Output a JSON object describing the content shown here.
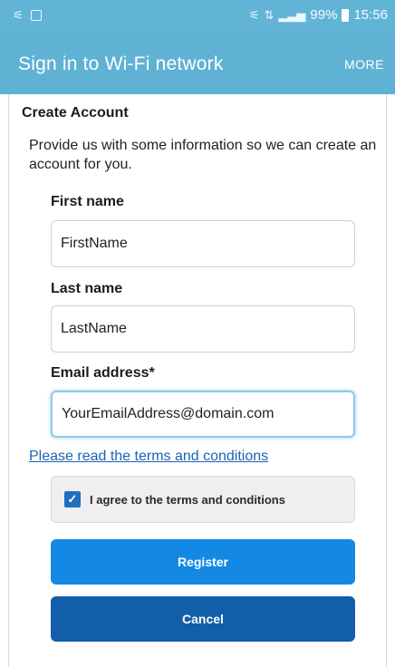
{
  "status_bar": {
    "battery": "99%",
    "time": "15:56"
  },
  "app_bar": {
    "title": "Sign in to Wi-Fi network",
    "more": "MORE"
  },
  "form": {
    "heading": "Create Account",
    "intro": "Provide us with some information so we can create an account for you.",
    "first_name_label": "First name",
    "first_name_value": "FirstName",
    "last_name_label": "Last name",
    "last_name_value": "LastName",
    "email_label": "Email address*",
    "email_value": "YourEmailAddress@domain.com",
    "terms_link": "Please read the terms and conditions",
    "agree_label": "I agree to the terms and conditions",
    "agree_checked": true,
    "register": "Register",
    "cancel": "Cancel"
  },
  "colors": {
    "app_bar": "#5fb2d4",
    "register": "#1389e4",
    "cancel": "#135ea8",
    "link": "#1a63b5"
  }
}
